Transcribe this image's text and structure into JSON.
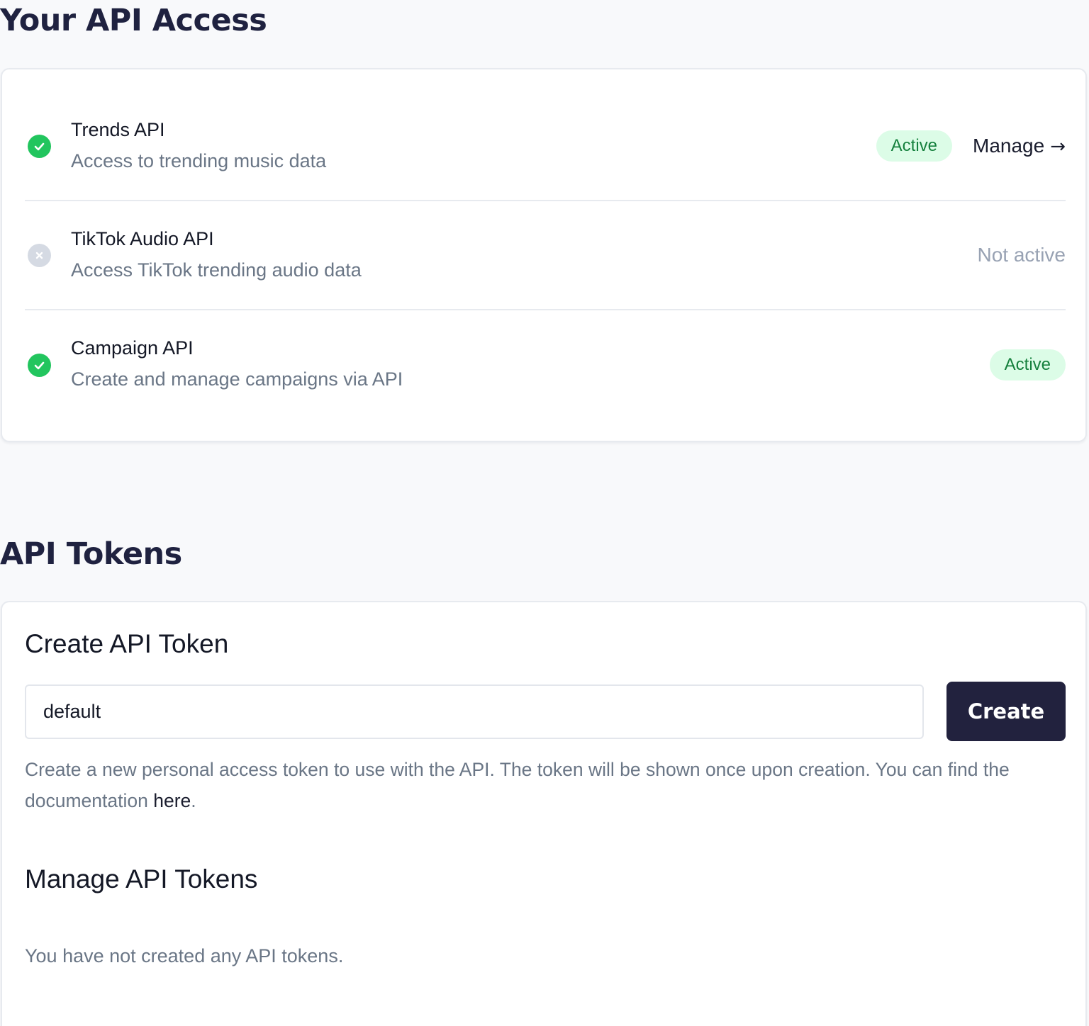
{
  "api_access": {
    "title": "Your API Access",
    "apis": [
      {
        "name": "Trends API",
        "description": "Access to trending music data",
        "active": true,
        "status_label": "Active",
        "manage_label": "Manage",
        "manage_arrow": "→"
      },
      {
        "name": "TikTok Audio API",
        "description": "Access TikTok trending audio data",
        "active": false,
        "status_label": "Not active"
      },
      {
        "name": "Campaign API",
        "description": "Create and manage campaigns via API",
        "active": true,
        "status_label": "Active"
      }
    ]
  },
  "api_tokens": {
    "title": "API Tokens",
    "create": {
      "heading": "Create API Token",
      "input_value": "default",
      "button_label": "Create",
      "help_text_before": "Create a new personal access token to use with the API. The token will be shown once upon creation. You can find the documentation ",
      "help_link_label": "here",
      "help_text_after": "."
    },
    "manage": {
      "heading": "Manage API Tokens",
      "empty_message": "You have not created any API tokens."
    }
  },
  "colors": {
    "page_background": "#f8f9fb",
    "active_green": "#22c55e",
    "badge_background": "#dcfce7",
    "badge_text": "#15803d",
    "inactive_icon": "#d5dae3",
    "primary_button": "#22223e",
    "muted_text": "#6a7686"
  },
  "icons": {
    "active": "check-circle-icon",
    "inactive": "x-circle-icon"
  }
}
